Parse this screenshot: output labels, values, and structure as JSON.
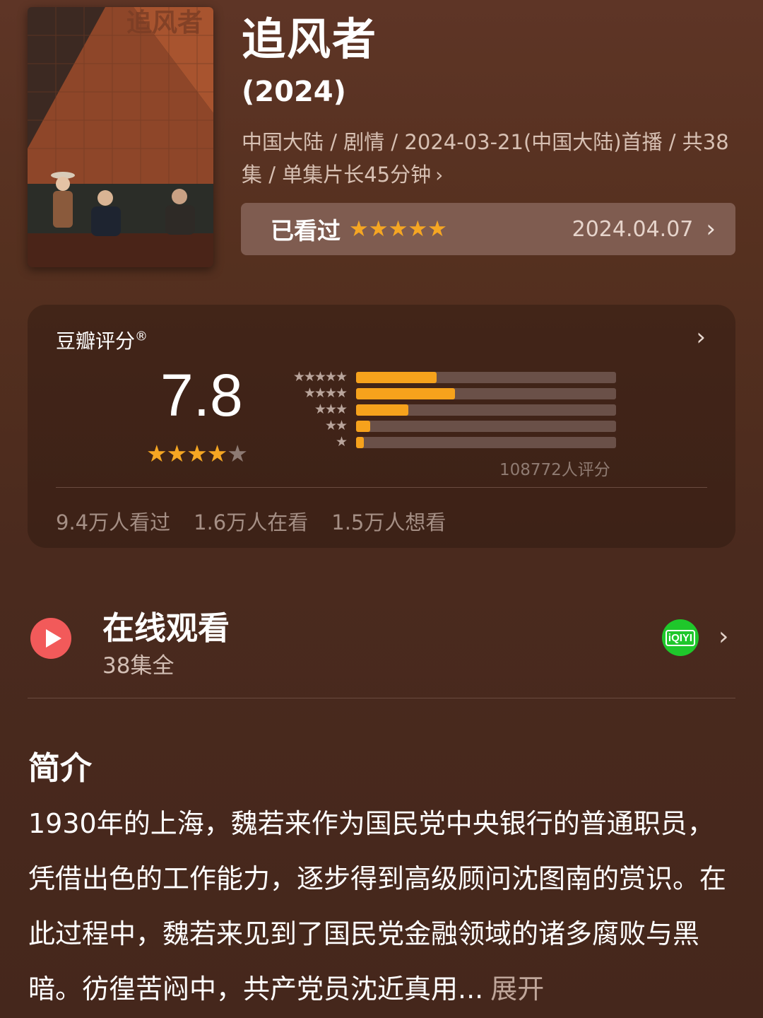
{
  "header": {
    "title": "追风者",
    "year": "(2024)",
    "meta": "中国大陆 / 剧情 / 2024-03-21(中国大陆)首播 / 共38集 / 单集片长45分钟",
    "meta_chevron": "›"
  },
  "poster": {
    "title_text": "追风者",
    "colors": {
      "brick": "#a3502f",
      "shadow": "#1c1612",
      "table": "#4a2418"
    }
  },
  "watched_box": {
    "label": "已看过",
    "stars": "★★★★★",
    "date": "2024.04.07",
    "chevron": "›"
  },
  "rating": {
    "title": "豆瓣评分",
    "registered": "®",
    "score": "7.8",
    "stars_on": "★★★★",
    "stars_off": "★",
    "distribution": [
      {
        "stars": "★★★★★",
        "fraction": 0.31
      },
      {
        "stars": "★★★★",
        "fraction": 0.38
      },
      {
        "stars": "★★★",
        "fraction": 0.2
      },
      {
        "stars": "★★",
        "fraction": 0.055
      },
      {
        "stars": "★",
        "fraction": 0.03
      }
    ],
    "count": "108772人评分",
    "stats": [
      "9.4万人看过",
      "1.6万人在看",
      "1.5万人想看"
    ],
    "chevron": "›"
  },
  "online": {
    "title": "在线观看",
    "subtitle": "38集全",
    "provider_logo_text": "iQIYI",
    "chevron": "›"
  },
  "intro": {
    "title": "简介",
    "text": "1930年的上海，魏若来作为国民党中央银行的普通职员，凭借出色的工作能力，逐步得到高级顾问沈图南的赏识。在此过程中，魏若来见到了国民党金融领域的诸多腐败与黑暗。彷徨苦闷中，共产党员沈近真用...",
    "expand": "展开"
  },
  "colors": {
    "accent_star": "#f5a623",
    "bar": "#f6a21c",
    "play": "#f25a5a",
    "iqiyi": "#1fc72b"
  }
}
